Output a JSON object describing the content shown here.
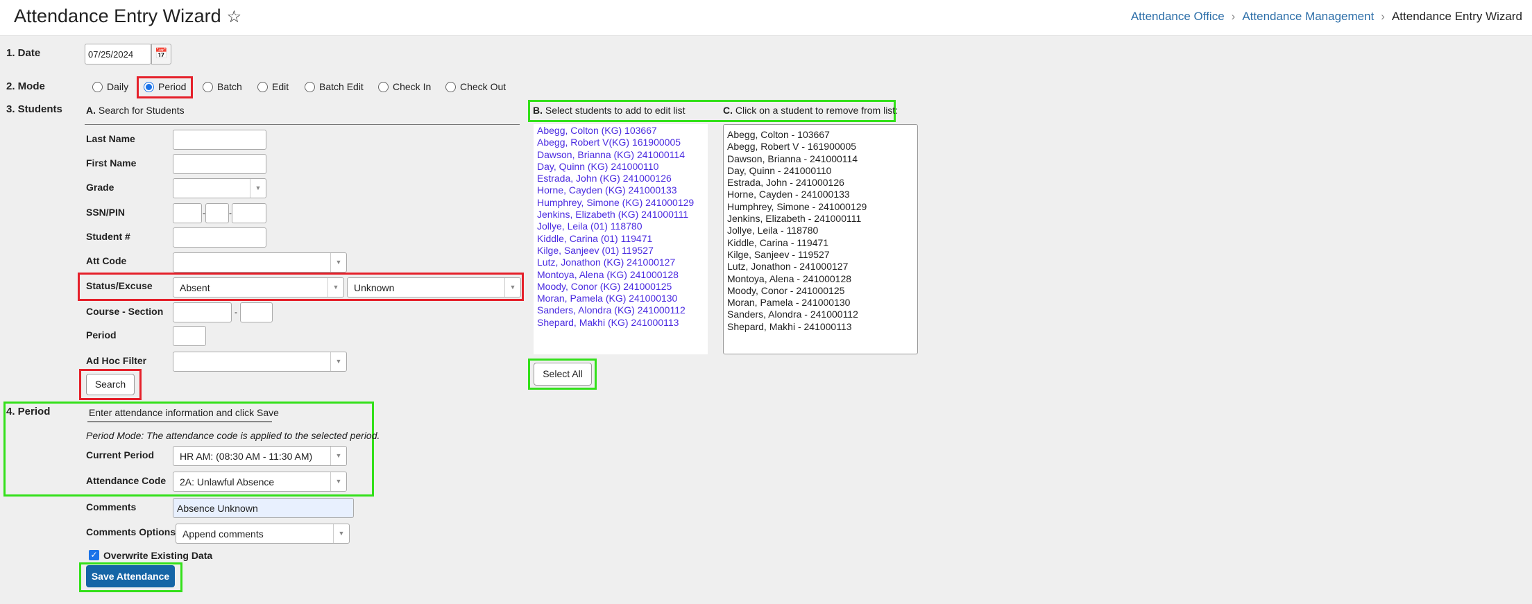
{
  "header": {
    "title": "Attendance Entry Wizard",
    "favorite_icon": "star-outline-icon",
    "breadcrumb": [
      "Attendance Office",
      "Attendance Management",
      "Attendance Entry Wizard"
    ]
  },
  "date": {
    "label": "1. Date",
    "value": "07/25/2024",
    "icon": "calendar-icon"
  },
  "mode": {
    "label": "2. Mode",
    "options": [
      "Daily",
      "Period",
      "Batch",
      "Edit",
      "Batch Edit",
      "Check In",
      "Check Out"
    ],
    "selected": "Period"
  },
  "students": {
    "label": "3. Students",
    "search_heading_prefix": "A.",
    "search_heading": " Search for Students",
    "fields": {
      "last_name": "Last Name",
      "first_name": "First Name",
      "grade": "Grade",
      "ssn": "SSN/PIN",
      "student_num": "Student #",
      "att_code": "Att Code",
      "status_excuse": "Status/Excuse",
      "status_value": "Absent",
      "excuse_value": "Unknown",
      "course_section": "Course - Section",
      "period": "Period",
      "ad_hoc": "Ad Hoc Filter",
      "dash": "-"
    },
    "search_button": "Search",
    "b_prefix": "B.",
    "b_heading": " Select students to add to edit list",
    "c_prefix": "C.",
    "c_heading": " Click on a student to remove from list:",
    "available": [
      "Abegg, Colton (KG) 103667",
      "Abegg, Robert V(KG) 161900005",
      "Dawson, Brianna (KG) 241000114",
      "Day, Quinn (KG) 241000110",
      "Estrada, John (KG) 241000126",
      "Horne, Cayden (KG) 241000133",
      "Humphrey, Simone (KG) 241000129",
      "Jenkins, Elizabeth (KG) 241000111",
      "Jollye, Leila (01) 118780",
      "Kiddle, Carina (01) 119471",
      "Kilge, Sanjeev (01) 119527",
      "Lutz, Jonathon (KG) 241000127",
      "Montoya, Alena (KG) 241000128",
      "Moody, Conor (KG) 241000125",
      "Moran, Pamela (KG) 241000130",
      "Sanders, Alondra (KG) 241000112",
      "Shepard, Makhi (KG) 241000113"
    ],
    "selected": [
      "Abegg, Colton - 103667",
      "Abegg, Robert V - 161900005",
      "Dawson, Brianna - 241000114",
      "Day, Quinn - 241000110",
      "Estrada, John - 241000126",
      "Horne, Cayden - 241000133",
      "Humphrey, Simone - 241000129",
      "Jenkins, Elizabeth - 241000111",
      "Jollye, Leila - 118780",
      "Kiddle, Carina - 119471",
      "Kilge, Sanjeev - 119527",
      "Lutz, Jonathon - 241000127",
      "Montoya, Alena - 241000128",
      "Moody, Conor - 241000125",
      "Moran, Pamela - 241000130",
      "Sanders, Alondra - 241000112",
      "Shepard, Makhi - 241000113"
    ],
    "select_all_button": "Select All"
  },
  "period": {
    "label": "4. Period",
    "instruction": "Enter attendance information and click Save",
    "mode_note": "Period Mode: The attendance code is applied to the selected period.",
    "current_period_label": "Current Period",
    "current_period_value": "HR AM: (08:30 AM - 11:30 AM)",
    "attendance_code_label": "Attendance Code",
    "attendance_code_value": "2A: Unlawful Absence",
    "comments_label": "Comments",
    "comments_value": "Absence Unknown",
    "comments_options_label": "Comments Options",
    "comments_options_value": "Append comments",
    "overwrite_label": "Overwrite Existing Data",
    "overwrite_checked": true,
    "save_button": "Save Attendance"
  },
  "colors": {
    "accent": "#1565a6",
    "link": "#2c6ea8",
    "list_link": "#4a2be0",
    "highlight_red": "#e5202a",
    "highlight_green": "#33e01a"
  }
}
